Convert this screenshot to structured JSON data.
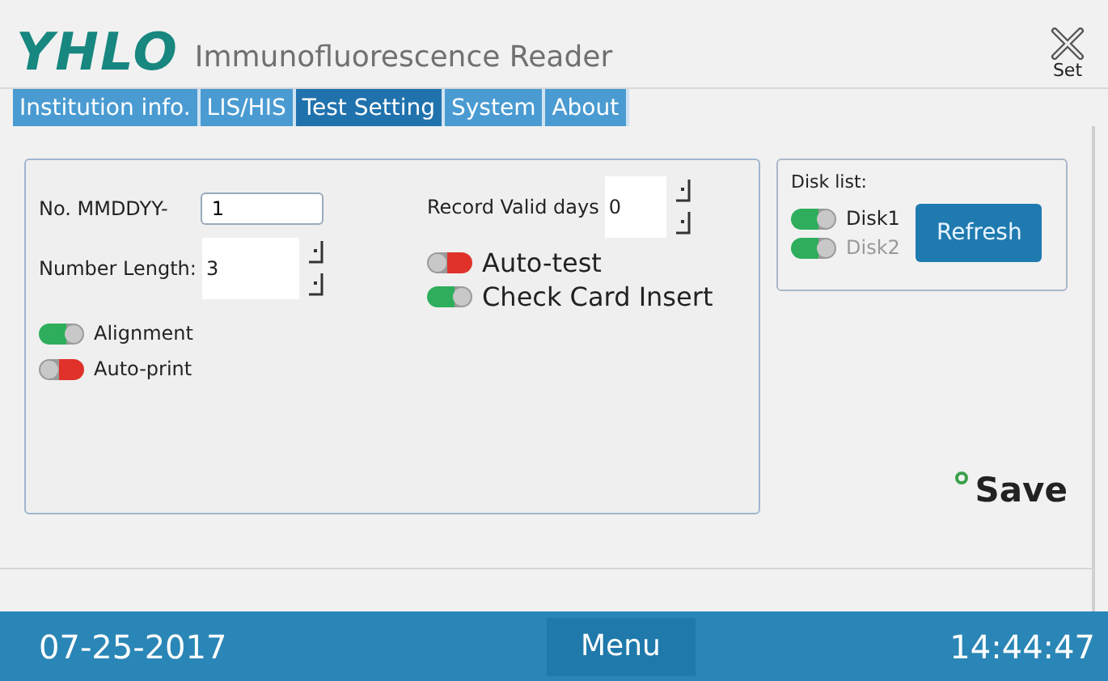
{
  "header": {
    "logo": "YHLO",
    "title": "Immunofluorescence Reader",
    "set_button": "Set"
  },
  "tabs": [
    {
      "label": "Institution info.",
      "selected": false
    },
    {
      "label": "LIS/HIS",
      "selected": false
    },
    {
      "label": "Test Setting",
      "selected": true
    },
    {
      "label": "System",
      "selected": false
    },
    {
      "label": "About",
      "selected": false
    }
  ],
  "settings": {
    "serial_prefix": {
      "label": "No.  MMDDYY-",
      "value": "1"
    },
    "number_length": {
      "label": "Number Length:",
      "value": "3"
    },
    "left_toggles": [
      {
        "label": "Alignment",
        "on": true
      },
      {
        "label": "Auto-print",
        "on": false
      }
    ],
    "record_valid_days": {
      "label": "Record Valid days",
      "value": "0"
    },
    "right_toggles": [
      {
        "label": "Auto-test",
        "on": false
      },
      {
        "label": "Check Card Insert",
        "on": true
      }
    ]
  },
  "disk_list": {
    "title": "Disk list:",
    "disks": [
      {
        "label": "Disk1",
        "on": true,
        "disabled": false
      },
      {
        "label": "Disk2",
        "on": true,
        "disabled": true
      }
    ],
    "refresh_button": "Refresh"
  },
  "save_button": "Save",
  "footer": {
    "date": "07-25-2017",
    "menu_button": "Menu",
    "time": "14:44:47"
  }
}
